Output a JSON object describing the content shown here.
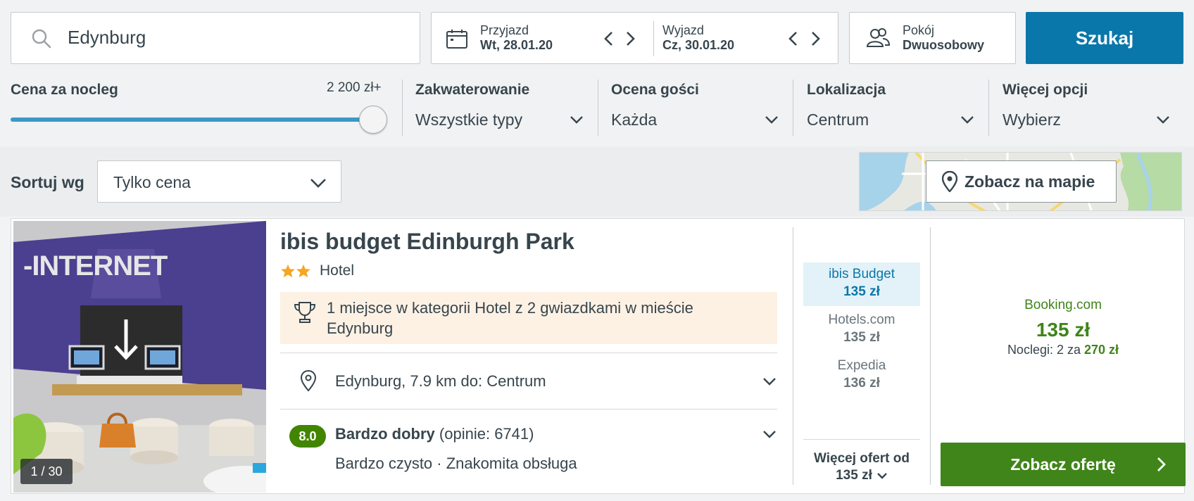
{
  "search": {
    "destination": "Edynburg",
    "checkin_label": "Przyjazd",
    "checkin_value": "Wt, 28.01.20",
    "checkout_label": "Wyjazd",
    "checkout_value": "Cz, 30.01.20",
    "room_label": "Pokój",
    "room_value": "Dwuosobowy",
    "search_button": "Szukaj"
  },
  "filters": {
    "price_title": "Cena za nocleg",
    "price_max": "2 200 zł+",
    "price_slider_fraction": 1.0,
    "accommodation_title": "Zakwaterowanie",
    "accommodation_value": "Wszystkie typy",
    "rating_title": "Ocena gości",
    "rating_value": "Każda",
    "location_title": "Lokalizacja",
    "location_value": "Centrum",
    "more_title": "Więcej opcji",
    "more_value": "Wybierz"
  },
  "sort": {
    "label": "Sortuj wg",
    "value": "Tylko cena",
    "map_button": "Zobacz na mapie"
  },
  "hotel": {
    "photo_counter": "1 / 30",
    "photo_sign_text": "-INTERNET",
    "name": "ibis budget Edinburgh Park",
    "stars": 2,
    "type": "Hotel",
    "award": "1 miejsce w kategorii Hotel z 2 gwiazdkami w mieście Edynburg",
    "location": "Edynburg, 7.9 km do: Centrum",
    "rating_score": "8.0",
    "rating_text": "Bardzo dobry",
    "reviews": "(opinie: 6741)",
    "highlights": "Bardzo czysto · Znakomita obsługa",
    "deals": [
      {
        "name": "ibis Budget",
        "price": "135 zł"
      },
      {
        "name": "Hotels.com",
        "price": "135 zł"
      },
      {
        "name": "Expedia",
        "price": "136 zł"
      }
    ],
    "more_offers_label": "Więcej ofert od",
    "more_offers_price": "135 zł",
    "best": {
      "provider": "Booking.com",
      "price": "135 zł",
      "nights_label": "Noclegi: 2 za",
      "nights_total": "270 zł",
      "cta": "Zobacz ofertę"
    }
  },
  "colors": {
    "primary_blue": "#0a77aa",
    "deal_green": "#3f8519",
    "rating_green": "#428500",
    "award_bg": "#fdf1e4",
    "highlight_deal_bg": "#e3f2f9",
    "star": "#f5a623"
  }
}
